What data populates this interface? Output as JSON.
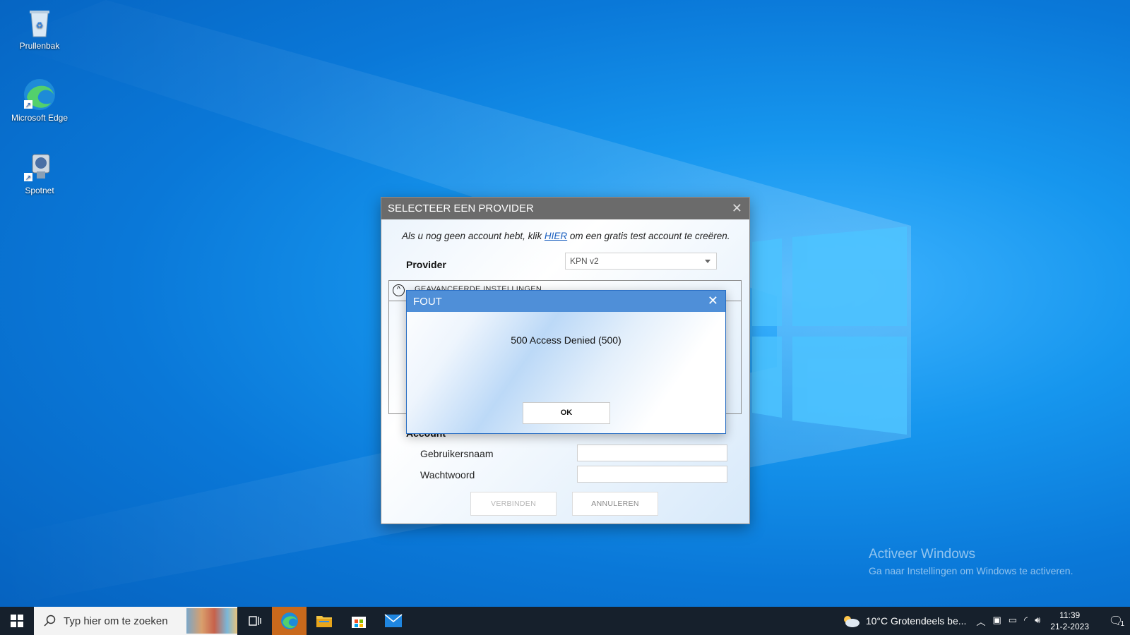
{
  "desktop": {
    "icons": [
      {
        "label": "Prullenbak",
        "icon": "recycle-bin-icon"
      },
      {
        "label": "Microsoft Edge",
        "icon": "edge-icon"
      },
      {
        "label": "Spotnet",
        "icon": "spotnet-icon"
      }
    ],
    "watermark": {
      "line1": "Activeer Windows",
      "line2": "Ga naar Instellingen om Windows te activeren."
    }
  },
  "dialog": {
    "title": "SELECTEER EEN PROVIDER",
    "intro_before": "Als u nog geen account hebt, klik ",
    "intro_link": "HIER",
    "intro_after": " om een gratis test account te creëren.",
    "provider_label": "Provider",
    "provider_value": "KPN v2",
    "advanced_title": "GEAVANCEERDE INSTELLINGEN",
    "account_label": "Account",
    "username_label": "Gebruikersnaam",
    "password_label": "Wachtwoord",
    "username_value": "",
    "password_value": "",
    "connect_label": "VERBINDEN",
    "cancel_label": "ANNULEREN"
  },
  "error": {
    "title": "FOUT",
    "message": "500 Access Denied (500)",
    "ok_label": "OK"
  },
  "taskbar": {
    "search_placeholder": "Typ hier om te zoeken",
    "weather": "10°C  Grotendeels be...",
    "time": "11:39",
    "date": "21-2-2023",
    "notification_count": "1",
    "apps": [
      "task-view-icon",
      "edge-icon",
      "file-explorer-icon",
      "store-icon",
      "mail-icon"
    ],
    "active_app": "edge-icon",
    "active_color": "#c9691c"
  },
  "colors": {
    "dialog_title_bg": "#6b6b6b",
    "error_title_bg": "#4f8fd8",
    "taskbar_bg": "#16202c"
  }
}
